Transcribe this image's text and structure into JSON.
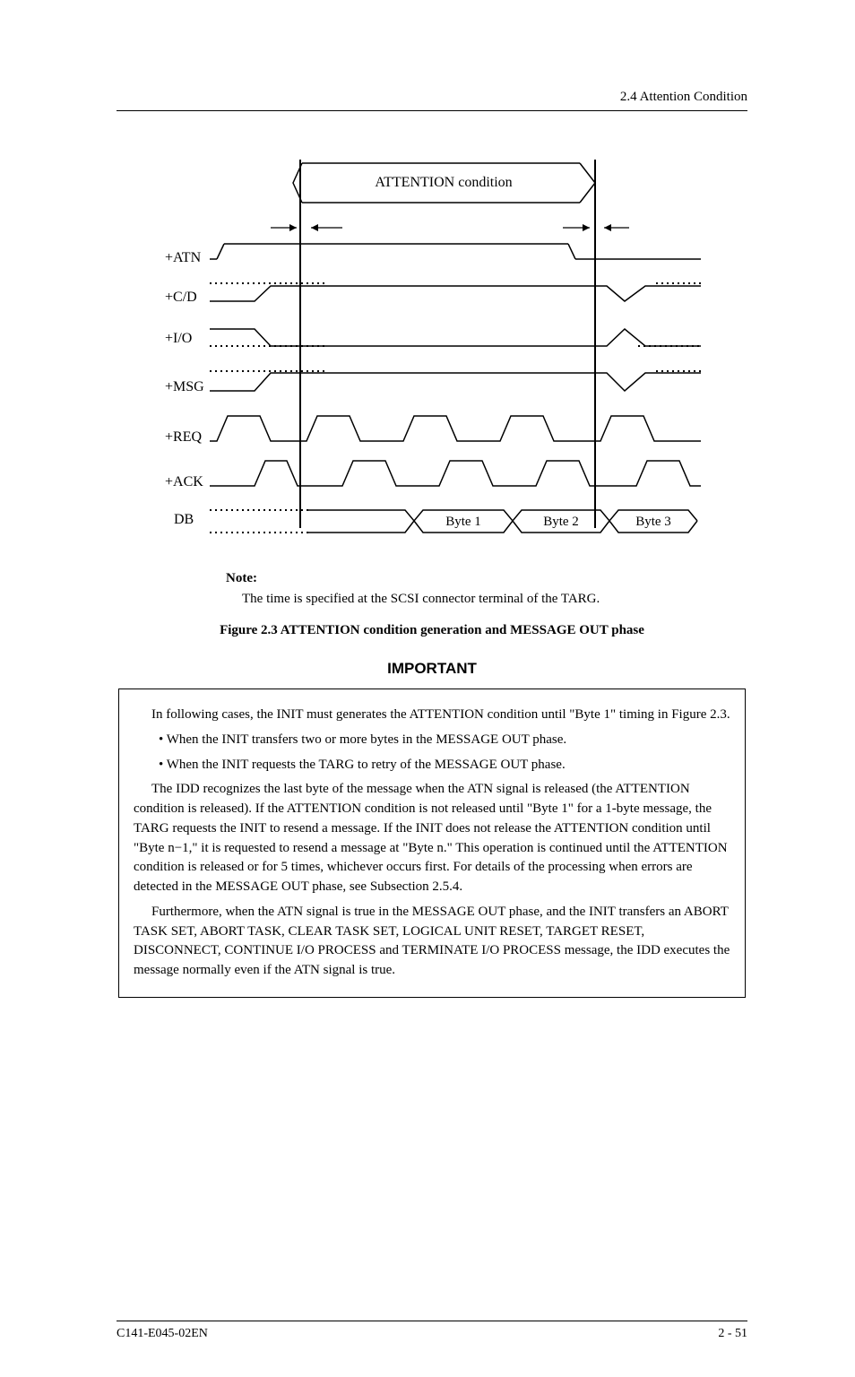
{
  "header": {
    "section": "2.4 Attention Condition"
  },
  "diagram": {
    "title": "ATTENTION condition",
    "signals": [
      "+ATN",
      "+C/D",
      "+I/O",
      "+MSG",
      "+REQ",
      "+ACK",
      "DB"
    ],
    "bytes": [
      "Byte 1",
      "Byte 2",
      "Byte 3"
    ]
  },
  "note": {
    "label": "Note:",
    "text": "The time is specified at the SCSI connector terminal of the TARG."
  },
  "figure_caption": "Figure 2.3  ATTENTION condition generation and MESSAGE OUT phase",
  "important_label": "IMPORTANT",
  "important": {
    "p1": "In following cases, the INIT must generates the ATTENTION condition until \"Byte 1\" timing in Figure 2.3.",
    "b1": "• When the INIT transfers two or more bytes in the MESSAGE OUT phase.",
    "b2": "• When the INIT requests the TARG to retry of the MESSAGE OUT phase.",
    "p2": "The IDD recognizes the last byte of the message when the ATN signal is released (the ATTENTION condition is released). If the ATTENTION condition is not released until \"Byte 1\" for a 1-byte message, the TARG requests the INIT to resend a message. If the INIT does not release the ATTENTION condition until \"Byte n−1,\" it is requested to resend a message at \"Byte n.\" This operation is continued until the ATTENTION condition is released or for 5 times, whichever occurs first. For details of the processing when errors are detected in the MESSAGE OUT phase, see Subsection 2.5.4.",
    "p3": "Furthermore, when the ATN signal is true in the MESSAGE OUT phase, and the INIT transfers an ABORT TASK SET, ABORT TASK, CLEAR TASK SET, LOGICAL UNIT RESET, TARGET RESET, DISCONNECT, CONTINUE I/O PROCESS and TERMINATE I/O PROCESS message, the IDD executes the message normally even if the ATN signal is true."
  },
  "footer": {
    "left": "C141-E045-02EN",
    "right": "2 - 51"
  }
}
